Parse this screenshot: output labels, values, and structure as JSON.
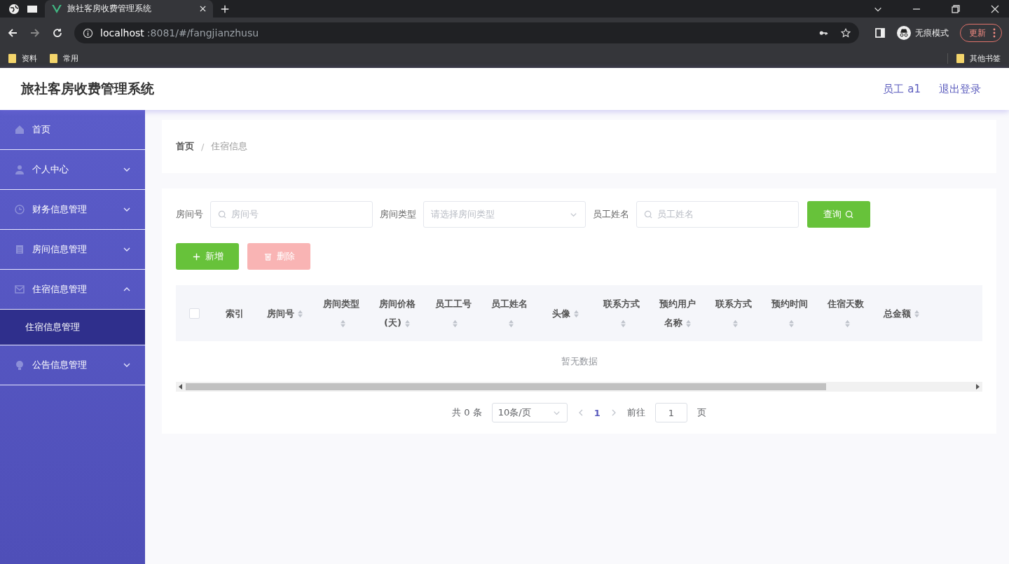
{
  "browser": {
    "tabs": [
      {
        "title": "旅社客房收费管理系统",
        "selected": true
      }
    ],
    "url_host": "localhost",
    "url_path": ":8081/#/fangjianzhusu",
    "incognito_label": "无痕模式",
    "update_button": "更新",
    "bookmarks": [
      "资料",
      "常用"
    ],
    "other_bookmarks": "其他书签"
  },
  "header": {
    "title": "旅社客房收费管理系统",
    "user": "员工 a1",
    "logout": "退出登录"
  },
  "sidebar": {
    "items": [
      {
        "label": "首页"
      },
      {
        "label": "个人中心",
        "expanded": false
      },
      {
        "label": "财务信息管理",
        "expanded": false
      },
      {
        "label": "房间信息管理",
        "expanded": false
      },
      {
        "label": "住宿信息管理",
        "expanded": true,
        "children": [
          {
            "label": "住宿信息管理",
            "selected": true
          }
        ]
      },
      {
        "label": "公告信息管理",
        "expanded": false
      }
    ]
  },
  "breadcrumb": [
    "首页",
    "住宿信息"
  ],
  "breadcrumb_separator": "/",
  "filters": [
    {
      "label": "房间号",
      "placeholder": "房间号",
      "kind": "text"
    },
    {
      "label": "房间类型",
      "placeholder": "请选择房间类型",
      "kind": "select"
    },
    {
      "label": "员工姓名",
      "placeholder": "员工姓名",
      "kind": "text"
    }
  ],
  "search_button": "查询",
  "actions": [
    {
      "label": "新增",
      "kind": "add",
      "disabled": false
    },
    {
      "label": "删除",
      "kind": "delete",
      "disabled": true
    }
  ],
  "table": {
    "select_all_checked": false,
    "columns": [
      {
        "label": "索引",
        "kind": "index"
      },
      {
        "label": "房间号",
        "kind": "sortable"
      },
      {
        "label": "房间类型",
        "kind": "sortable"
      },
      {
        "label": "房间价格(天)",
        "kind": "sortable"
      },
      {
        "label": "员工工号",
        "kind": "sortable"
      },
      {
        "label": "员工姓名",
        "kind": "sortable"
      },
      {
        "label": "头像",
        "kind": "sortable"
      },
      {
        "label": "联系方式",
        "kind": "sortable"
      },
      {
        "label": "预约用户名称",
        "kind": "sortable"
      },
      {
        "label": "联系方式",
        "kind": "sortable"
      },
      {
        "label": "预约时间",
        "kind": "sortable"
      },
      {
        "label": "住宿天数",
        "kind": "sortable"
      },
      {
        "label": "总金额",
        "kind": "sortable"
      }
    ],
    "empty_text": "暂无数据"
  },
  "pagination": {
    "total": "共 0 条",
    "page_size": "10条/页",
    "pages": [
      {
        "label": "1",
        "selected": true
      }
    ],
    "goto_label": "前往",
    "goto_value": "1",
    "goto_suffix": "页"
  }
}
